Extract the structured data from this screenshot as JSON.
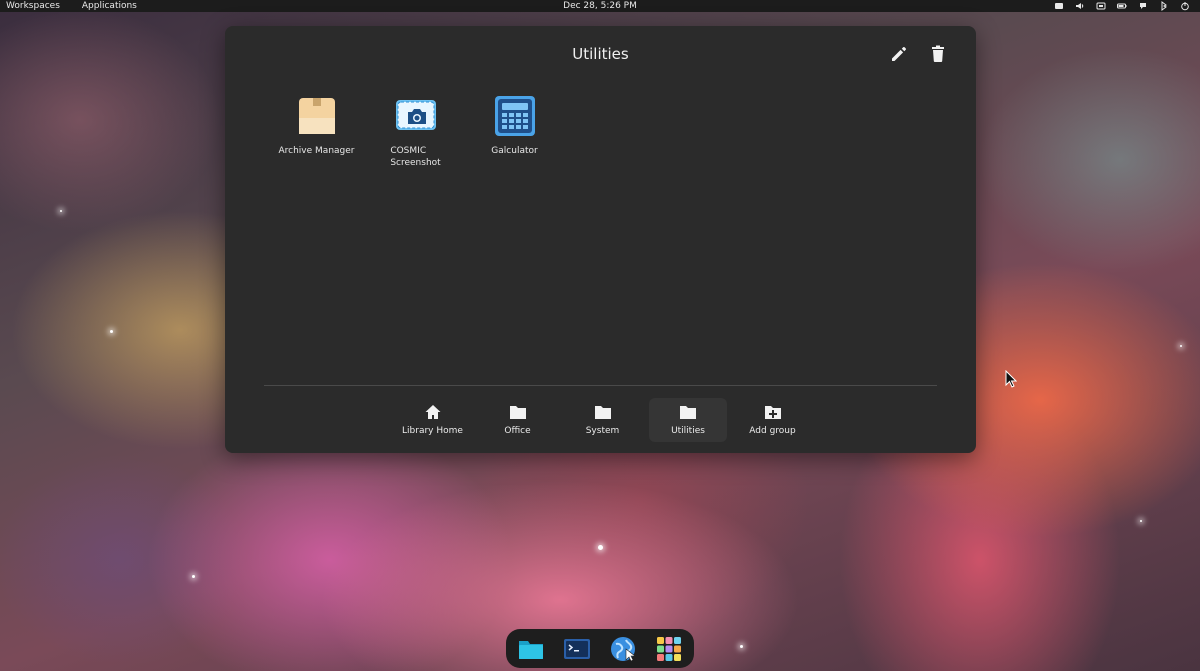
{
  "top_panel": {
    "workspaces_label": "Workspaces",
    "applications_label": "Applications",
    "clock": "Dec 28, 5:26 PM",
    "tray_icons": [
      "notification-icon",
      "volume-icon",
      "network-icon",
      "battery-icon",
      "bluetooth-icon",
      "chat-icon",
      "power-icon"
    ]
  },
  "launcher": {
    "title": "Utilities",
    "apps": [
      {
        "label": "Archive Manager",
        "icon": "archive-icon"
      },
      {
        "label": "COSMIC\nScreenshot",
        "icon": "screenshot-icon"
      },
      {
        "label": "Galculator",
        "icon": "calculator-icon"
      }
    ],
    "groups": [
      {
        "label": "Library Home",
        "icon": "home-icon"
      },
      {
        "label": "Office",
        "icon": "folder-icon"
      },
      {
        "label": "System",
        "icon": "folder-icon"
      },
      {
        "label": "Utilities",
        "icon": "folder-icon",
        "active": true
      },
      {
        "label": "Add group",
        "icon": "add-folder-icon"
      }
    ]
  },
  "dock": {
    "items": [
      "files-icon",
      "terminal-icon",
      "browser-icon",
      "app-library-icon"
    ]
  },
  "colors": {
    "panel_bg": "#2b2b2b",
    "accent_blue": "#4aa3e8",
    "folder_cyan": "#2ec4e6"
  }
}
